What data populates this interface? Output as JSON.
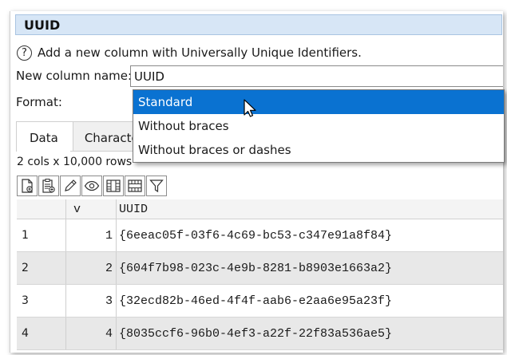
{
  "title": "UUID",
  "description": "Add a new column with Universally Unique Identifiers.",
  "column_name": {
    "label": "New column name:",
    "value": "UUID"
  },
  "format": {
    "label": "Format:",
    "options": [
      "Standard",
      "Without braces",
      "Without braces or dashes"
    ],
    "selected_index": 0
  },
  "tabs": [
    {
      "label": "Data",
      "active": true
    },
    {
      "label": "Characte",
      "active": false
    }
  ],
  "rows_info": "2 cols x 10,000 rows",
  "toolbar": {
    "icons": [
      "new-file-icon",
      "paste-icon",
      "edit-icon",
      "view-icon",
      "columns-icon",
      "rows-icon",
      "filter-icon"
    ]
  },
  "table": {
    "headers": [
      "",
      "v",
      "UUID"
    ],
    "rows": [
      [
        "1",
        "1",
        "{6eeac05f-03f6-4c69-bc53-c347e91a8f84}"
      ],
      [
        "2",
        "2",
        "{604f7b98-023c-4e9b-8281-b8903e1663a2}"
      ],
      [
        "3",
        "3",
        "{32ecd82b-46ed-4f4f-aab6-e2aa6e95a23f}"
      ],
      [
        "4",
        "4",
        "{8035ccf6-96b0-4ef3-a22f-22f83a536ae5}"
      ]
    ]
  },
  "colors": {
    "selection": "#0a72d1",
    "title_bar": "#d7e6f6",
    "alt_row": "#e8e8e8"
  }
}
